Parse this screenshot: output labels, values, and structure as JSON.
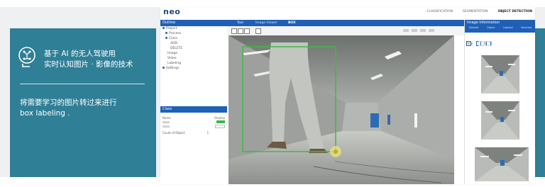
{
  "left_panel": {
    "headline_line1": "基于 AI 的无人驾驶用",
    "headline_line2": "实时认知图片 · 影像的技术",
    "desc_line1": "将需要学习的图片转过来进行",
    "desc_line2": "box labeling ."
  },
  "app": {
    "logo": "neo",
    "nav": [
      "CLASSIFICATION",
      "SEGMENTATION",
      "OBJECT DETECTION"
    ],
    "outline": {
      "title": "Outline",
      "items": [
        "Project",
        "Process",
        "Class",
        "ADD",
        "DELETE",
        "Image",
        "Video",
        "Labeling",
        "Settings"
      ]
    },
    "tabs": [
      "Tool",
      "Image Viewer",
      "BOX"
    ],
    "class_panel": {
      "title": "Class",
      "headers": [
        "Name",
        "Display"
      ],
      "rows": [
        "class",
        "class"
      ],
      "footer": "Count of Object",
      "footer_value": "1"
    },
    "right_panel": {
      "title": "Image Information",
      "columns": [
        "Dataset",
        "Object",
        "Labeled",
        "Selected"
      ],
      "filter_label": "Filter",
      "filter_value": "All"
    },
    "colors": {
      "header_blue": "#1f60b6",
      "bbox_green": "#3fb944",
      "teal": "#2f7f96"
    }
  }
}
